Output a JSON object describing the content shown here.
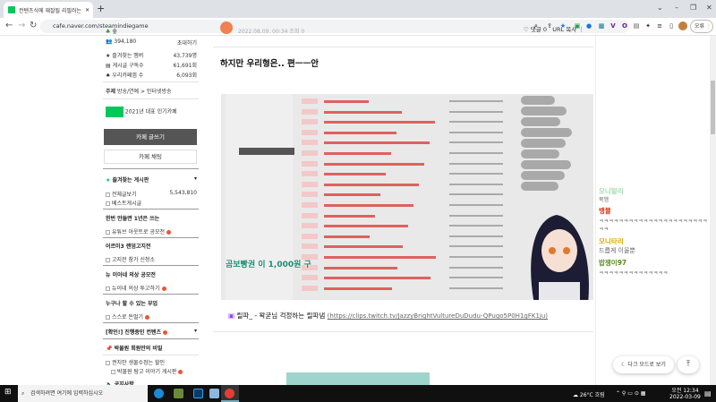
{
  "browser": {
    "tab_title": "컨텐츠식에 재잘될 리필러는",
    "url": "cafe.naver.com/steamindiegame",
    "profile_label": "오류"
  },
  "sidebar": {
    "level": "숲",
    "members": "394,180",
    "invite": "초대하기",
    "stats": [
      {
        "label": "즐겨찾는 멤버",
        "value": "43,739명"
      },
      {
        "label": "게시글 구독수",
        "value": "61,691회"
      },
      {
        "label": "우리카페앱 수",
        "value": "6,093회"
      }
    ],
    "topic_label": "주제",
    "topic": "방송/연예 > 인터넷방송",
    "award": "2021년 대표 인기카페",
    "write_button": "카페 글쓰기",
    "chat_button": "카페 채팅",
    "fav_boards": "즐겨찾는 게시판",
    "all_posts": "전체글보기",
    "all_posts_count": "5,543,810",
    "best_posts": "베스트게시글",
    "sections": [
      {
        "head": "한번 만들면 1년은 쓰는",
        "item": "유튜브 아웃트로 공모전"
      },
      {
        "head": "어르미3 랜덤고지전",
        "item": "고지전 참가 신청소"
      },
      {
        "head": "뉴 이아네 의상 공모전",
        "item": "뉴이네 의상 투고하기"
      },
      {
        "head": "누구나 할 수 있는 부업",
        "item": "스스로 돈벌기"
      }
    ],
    "contents": "[확인!] 진행중인 컨텐츠",
    "secret": "박물원 회원만의 비밀",
    "secret_items": [
      "권치안 생물수정는 할인",
      "박물원 탐고 이야기 게시판"
    ],
    "notice": "공지사항"
  },
  "post": {
    "date": "2022.08.09. 00:34",
    "views": "조회 0",
    "comments": "댓글 0",
    "copy_url": "URL 복사",
    "heading": "하지만 우리형은.. 편ㅡㅡ안",
    "overlay_text": "곰보빵권 이 1,000원 구",
    "caption_title": "릴파_ - 왁굳님 걱정하는 릴파냄",
    "caption_link": "(https://clips.twitch.tv/JazzyBrightVultureDuDudu-QPugo5P0H1gFK1ju)"
  },
  "chat": [
    {
      "name": "모니털리",
      "msg": "묵엠",
      "color": "#a8dcb0"
    },
    {
      "name": "뱅뮬",
      "msg": "ㅋㅋㅋㅋㅋㅋㅋㅋㅋㅋㅋㅋㅋㅋㅋㅋㅋㅋㅋㅋㅋㅋㅋㅋ",
      "color": "#d2381a"
    },
    {
      "name": "모니타리",
      "msg": "드릅게 이울뿐",
      "color": "#e0a800"
    },
    {
      "name": "밥쟁이97",
      "msg": "ㅋㅋㅋㅋㅋㅋㅋㅋㅋㅋㅋㅋㅋㅋ",
      "color": "#5a8a1c"
    }
  ],
  "floating": {
    "dark_mode": "다크 모드로 보기",
    "top": "⤒"
  },
  "taskbar": {
    "search_placeholder": "검색하려면 여기에 입력하십시오",
    "weather": "26°C 흐림",
    "time": "오전 12:34",
    "date": "2022-03-09"
  }
}
